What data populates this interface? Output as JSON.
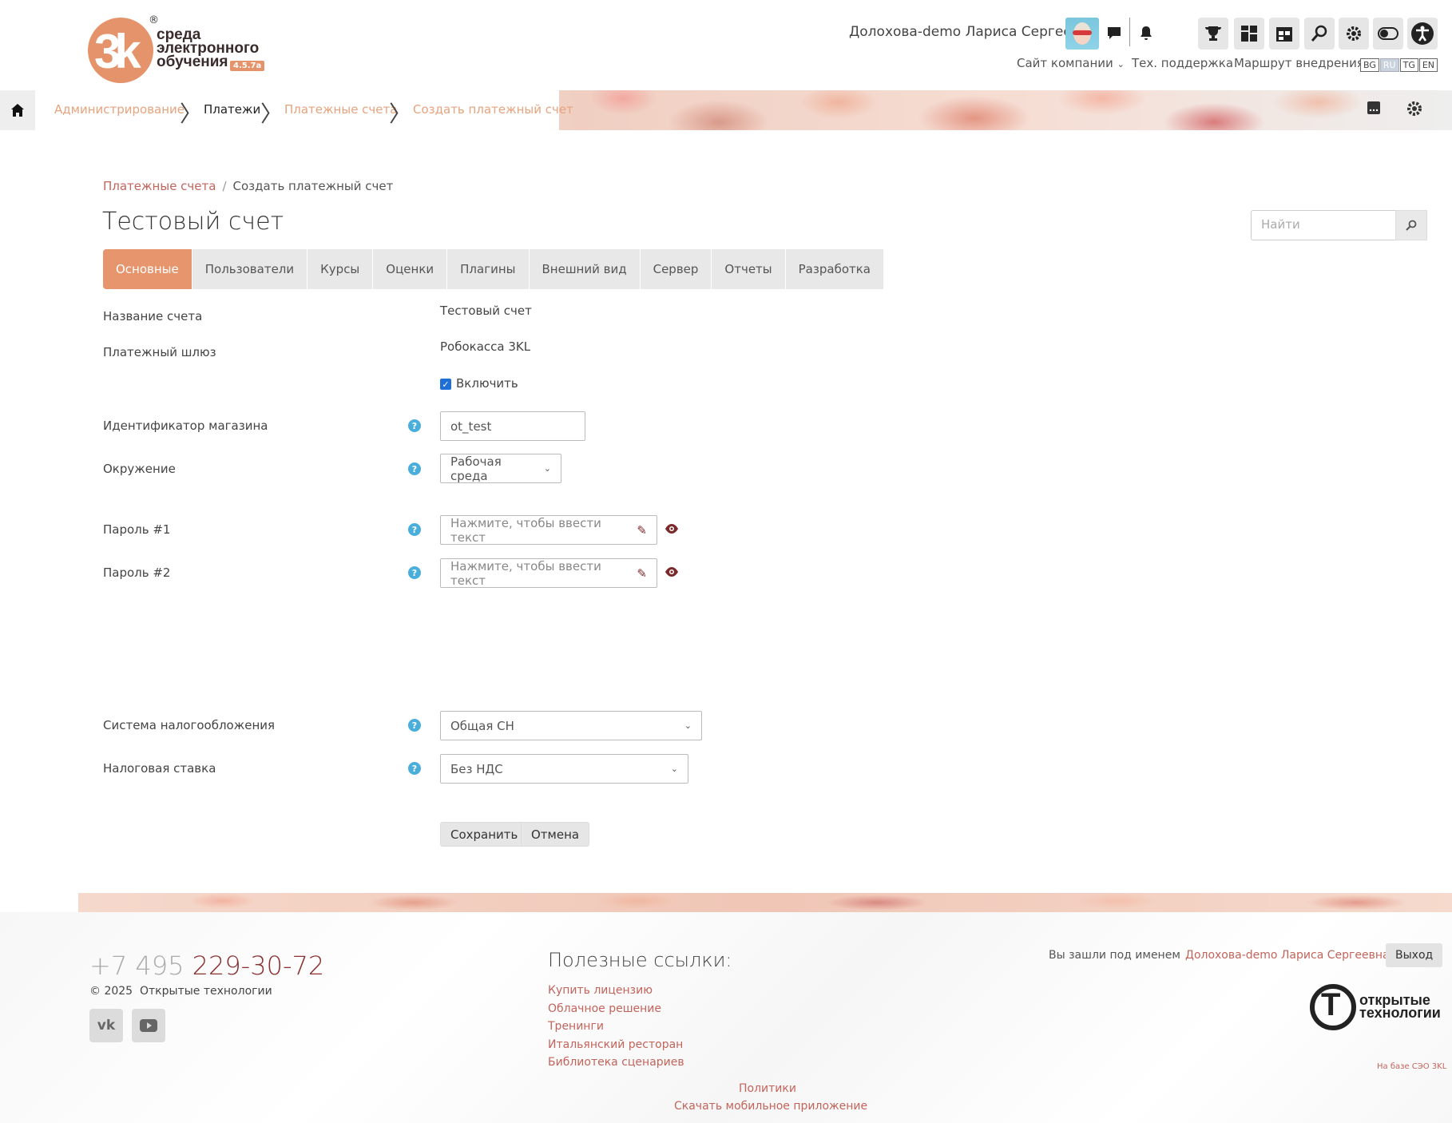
{
  "header": {
    "logo_text": "среда электронного обучения",
    "logo_mark": "3k",
    "version": "4.5.7a",
    "user_name": "Долохова-demo Лариса Сергеевна",
    "icons": [
      "chat-icon",
      "bell-icon",
      "trophy-icon",
      "dashboard-icon",
      "calendar-icon",
      "search-icon",
      "gear-icon",
      "toggle-icon",
      "accessibility-icon"
    ],
    "nav": {
      "company_site": "Сайт компании",
      "support": "Тех. поддержка",
      "route": "Маршрут внедрения"
    },
    "languages": [
      "BG",
      "RU",
      "TG",
      "EN"
    ],
    "active_language": "RU"
  },
  "breadcrumb_bar": {
    "items": [
      {
        "label": "Администрирование"
      },
      {
        "label": "Платежи"
      },
      {
        "label": "Платежные счета"
      },
      {
        "label": "Создать платежный счет"
      }
    ]
  },
  "page": {
    "crumbs": [
      "Платежные счета",
      "Создать платежный счет"
    ],
    "title": "Тестовый счет",
    "search_placeholder": "Найти"
  },
  "tabs": [
    {
      "label": "Основные",
      "active": true
    },
    {
      "label": "Пользователи"
    },
    {
      "label": "Курсы"
    },
    {
      "label": "Оценки"
    },
    {
      "label": "Плагины"
    },
    {
      "label": "Внешний вид"
    },
    {
      "label": "Сервер"
    },
    {
      "label": "Отчеты"
    },
    {
      "label": "Разработка"
    }
  ],
  "form": {
    "account_name_label": "Название счета",
    "account_name_value": "Тестовый счет",
    "gateway_label": "Платежный шлюз",
    "gateway_value": "Робокасса 3KL",
    "enable_label": "Включить",
    "enable_checked": true,
    "shop_id_label": "Идентификатор магазина",
    "shop_id_value": "ot_test",
    "environment_label": "Окружение",
    "environment_value": "Рабочая среда",
    "password1_label": "Пароль #1",
    "password1_placeholder": "Нажмите, чтобы ввести текст",
    "password2_label": "Пароль #2",
    "password2_placeholder": "Нажмите, чтобы ввести текст",
    "tax_system_label": "Система налогообложения",
    "tax_system_value": "Общая СН",
    "tax_rate_label": "Налоговая ставка",
    "tax_rate_value": "Без НДС",
    "save_label": "Сохранить",
    "cancel_label": "Отмена"
  },
  "footer": {
    "phone_prefix": "+7 495",
    "phone_number": "229-30-72",
    "copyright_year": "© 2025",
    "copyright_company": "Открытые технологии",
    "social": [
      "vk-icon",
      "youtube-icon"
    ],
    "useful_title": "Полезные ссылки:",
    "links": [
      "Купить лицензию",
      "Облачное решение",
      "Тренинги",
      "Итальянский ресторан",
      "Библиотека сценариев"
    ],
    "logged_in_text": "Вы зашли под именем",
    "logged_in_user": "Долохова-demo Лариса Сергеевна",
    "logout_label": "Выход",
    "ot_logo_line1": "открытые",
    "ot_logo_line2": "технологии",
    "based_on": "На базе СЭО 3KL",
    "policy": "Политики",
    "mobile_app": "Скачать мобильное приложение"
  },
  "colors": {
    "accent": "#e7956c",
    "link": "#c3645b",
    "help": "#4aaedc",
    "dark_red": "#8b2f2f"
  }
}
